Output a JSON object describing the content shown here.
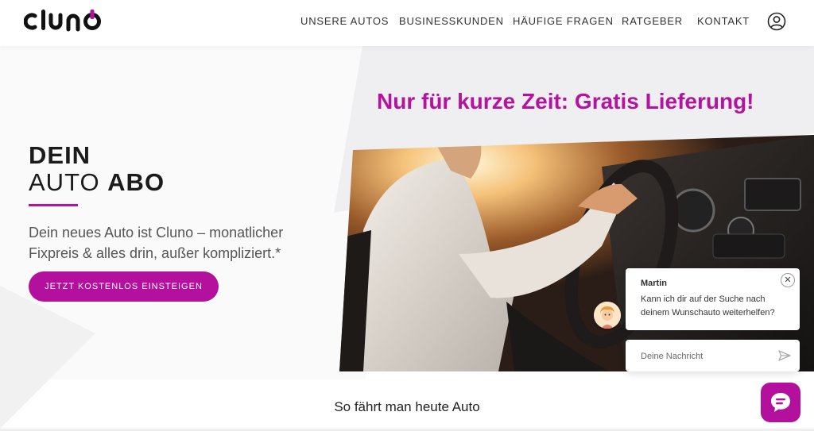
{
  "brand": {
    "logo_text": "cluno",
    "accent_color": "#b2109d"
  },
  "nav": {
    "items": [
      {
        "label": "UNSERE AUTOS"
      },
      {
        "label": "BUSINESSKUNDEN"
      },
      {
        "label": "HÄUFIGE FRAGEN"
      },
      {
        "label": "RATGEBER"
      },
      {
        "label": "KONTAKT"
      }
    ],
    "user_icon": "user-circle-icon"
  },
  "hero": {
    "title_line1": "DEIN",
    "title_line2_light": "AUTO ",
    "title_line2_bold": "ABO",
    "subtitle": "Dein neues Auto ist Cluno – monatlicher Fixpreis & alles drin, außer kompliziert.*",
    "cta_label": "JETZT KOSTENLOS EINSTEIGEN",
    "promo": "Nur für kurze Zeit: Gratis Lieferung!"
  },
  "chat": {
    "agent_name": "Martin",
    "message": "Kann ich dir auf der Suche nach deinem Wunschauto weiterhelfen?",
    "input_placeholder": "Deine Nachricht",
    "close_icon": "close-icon",
    "send_icon": "send-icon",
    "launcher_icon": "chat-bubble-icon"
  },
  "section": {
    "title": "So fährt man heute Auto"
  }
}
